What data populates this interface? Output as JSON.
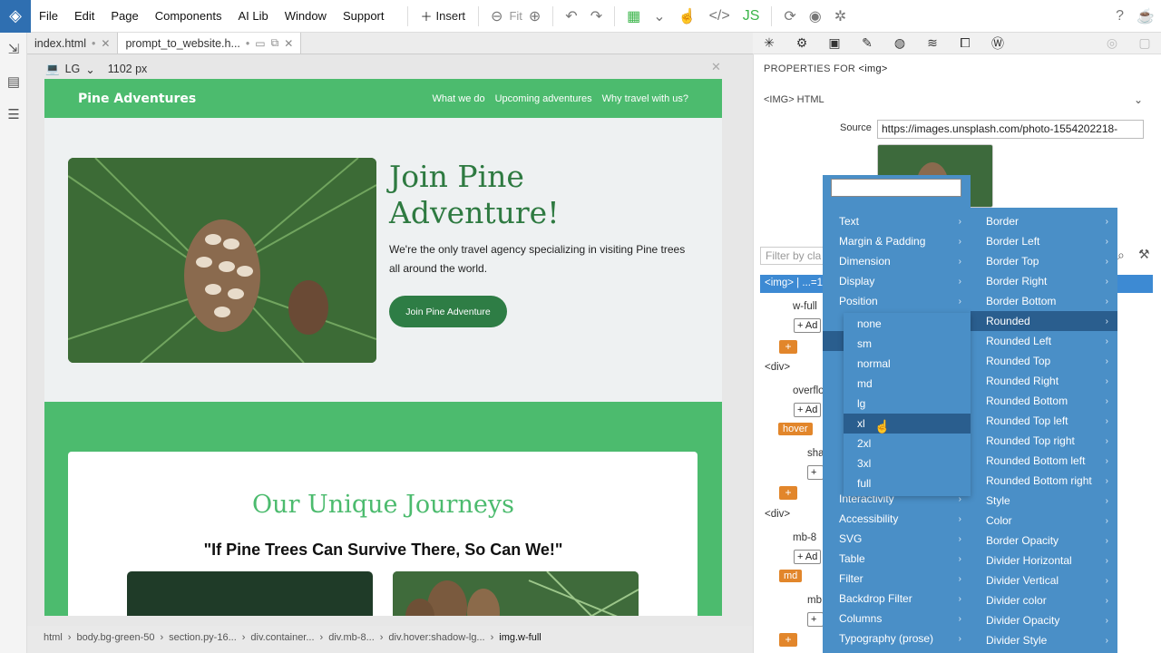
{
  "menubar": {
    "items": [
      "File",
      "Edit",
      "Page",
      "Components",
      "AI Lib",
      "Window",
      "Support"
    ],
    "insert": "Insert",
    "fit": "Fit"
  },
  "tabs": [
    {
      "name": "index.html",
      "mark": "•"
    },
    {
      "name": "prompt_to_website.h...",
      "mark": "•"
    }
  ],
  "device": {
    "name": "LG",
    "width": "1102 px"
  },
  "site": {
    "brand": "Pine Adventures",
    "nav": [
      "What we do",
      "Upcoming adventures",
      "Why travel with us?"
    ],
    "hero_title": "Join Pine Adventure!",
    "hero_text": "We're the only travel agency specializing in visiting Pine trees all around the world.",
    "hero_button": "Join Pine Adventure",
    "section_title": "Our Unique Journeys",
    "quote": "\"If Pine Trees Can Survive There, So Can We!\""
  },
  "breadcrumb": [
    "html",
    "body.bg-green-50",
    "section.py-16...",
    "div.container...",
    "div.mb-8...",
    "div.hover:shadow-lg...",
    "img.w-full"
  ],
  "props": {
    "header": "PROPERTIES FOR",
    "tag": "<img>",
    "section": "<IMG> HTML",
    "source_label": "Source",
    "source_value": "https://images.unsplash.com/photo-1554202218-",
    "filter_placeholder": "Filter by cla",
    "selected_row": "<img> | ...=1"
  },
  "tree": {
    "w_full": "w-full",
    "add": "+ Ad",
    "div": "<div>",
    "overflow": "overflo",
    "hover": "hover",
    "sha": "sha",
    "mb8": "mb-8",
    "md": "md",
    "mb": "mb"
  },
  "menu1": [
    "Text",
    "Margin & Padding",
    "Dimension",
    "Display",
    "Position",
    "Interactivity",
    "Accessibility",
    "SVG",
    "Table",
    "Filter",
    "Backdrop Filter",
    "Columns",
    "Typography (prose)"
  ],
  "menu2": [
    "Border",
    "Border Left",
    "Border Top",
    "Border Right",
    "Border Bottom",
    "Rounded",
    "Rounded Left",
    "Rounded Top",
    "Rounded Right",
    "Rounded Bottom",
    "Rounded Top left",
    "Rounded Top right",
    "Rounded Bottom left",
    "Rounded Bottom right",
    "Style",
    "Color",
    "Border Opacity",
    "Divider Horizontal",
    "Divider Vertical",
    "Divider color",
    "Divider Opacity",
    "Divider Style"
  ],
  "submenu": [
    "none",
    "sm",
    "normal",
    "md",
    "lg",
    "xl",
    "2xl",
    "3xl",
    "full"
  ],
  "highlighted": {
    "menu2": "Rounded",
    "submenu": "xl"
  },
  "colors": {
    "brand_green": "#4cbb6e",
    "dark_green": "#2e7d45",
    "menu_blue": "#4a8fc7",
    "highlight": "#2a5e8e",
    "orange": "#e2862b"
  }
}
